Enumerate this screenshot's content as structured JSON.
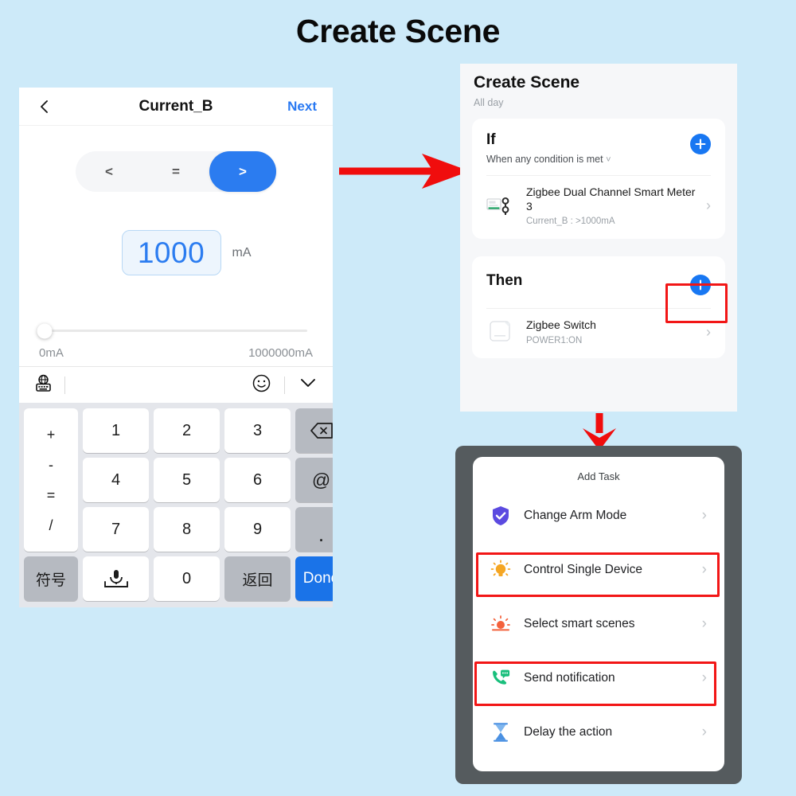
{
  "page": {
    "title": "Create Scene",
    "background_color": "#cdeaf9",
    "accent_blue": "#2b7cf0",
    "highlight_red": "#f21616"
  },
  "phone_a": {
    "navbar": {
      "back_icon": "chevron-left-icon",
      "title": "Current_B",
      "next_label": "Next"
    },
    "comparator": {
      "options": [
        "<",
        "=",
        ">"
      ],
      "selected": ">"
    },
    "value": {
      "amount": "1000",
      "unit": "mA"
    },
    "slider": {
      "min_label": "0mA",
      "max_label": "1000000mA",
      "position_percent": 2
    },
    "keyboard_toolbar": {
      "language_icon": "globe-keyboard-icon",
      "emoji_icon": "smiley-icon",
      "collapse_icon": "chevron-down-icon"
    },
    "keypad": {
      "operators": [
        "+",
        "-",
        "=",
        "/"
      ],
      "digits_row1": [
        "1",
        "2",
        "3"
      ],
      "digits_row2": [
        "4",
        "5",
        "6"
      ],
      "digits_row3": [
        "7",
        "8",
        "9"
      ],
      "backspace_icon": "backspace-icon",
      "at_key": "@",
      "dot_key": ".",
      "symbols_key": "符号",
      "mic_icon": "microphone-space-icon",
      "zero_key": "0",
      "return_key": "返回",
      "done_key": "Done"
    }
  },
  "phone_b": {
    "title": "Create Scene",
    "subtitle": "All day",
    "if_card": {
      "heading": "If",
      "condition_label": "When any condition is met",
      "caret_icon": "chevron-down-icon",
      "add_icon": "plus-circle-icon",
      "device": {
        "icon": "smart-meter-icon",
        "name": "Zigbee Dual Channel Smart Meter 3",
        "detail": "Current_B : >1000mA",
        "chevron": "chevron-right-icon"
      }
    },
    "then_card": {
      "heading": "Then",
      "add_icon": "plus-circle-icon",
      "device": {
        "icon": "switch-icon",
        "name": "Zigbee Switch",
        "detail": "POWER1:ON",
        "chevron": "chevron-right-icon"
      }
    }
  },
  "phone_c": {
    "sheet_title": "Add Task",
    "tasks": [
      {
        "label": "Change Arm Mode",
        "icon": "shield-check-icon",
        "color": "#5b4ae0",
        "highlighted": false
      },
      {
        "label": "Control Single Device",
        "icon": "lightbulb-icon",
        "color": "#f5a623",
        "highlighted": true
      },
      {
        "label": "Select smart scenes",
        "icon": "sunrise-icon",
        "color": "#f4613b",
        "highlighted": false
      },
      {
        "label": "Send notification",
        "icon": "phone-message-icon",
        "color": "#19bf7c",
        "highlighted": true
      },
      {
        "label": "Delay the action",
        "icon": "hourglass-icon",
        "color": "#4a90e2",
        "highlighted": false
      }
    ],
    "chevron_icon": "chevron-right-icon"
  },
  "arrows": [
    {
      "name": "arrow-left-to-middle",
      "direction": "right",
      "color": "#f00d0d"
    },
    {
      "name": "arrow-middle-to-bottom",
      "direction": "down",
      "color": "#f00d0d"
    }
  ]
}
